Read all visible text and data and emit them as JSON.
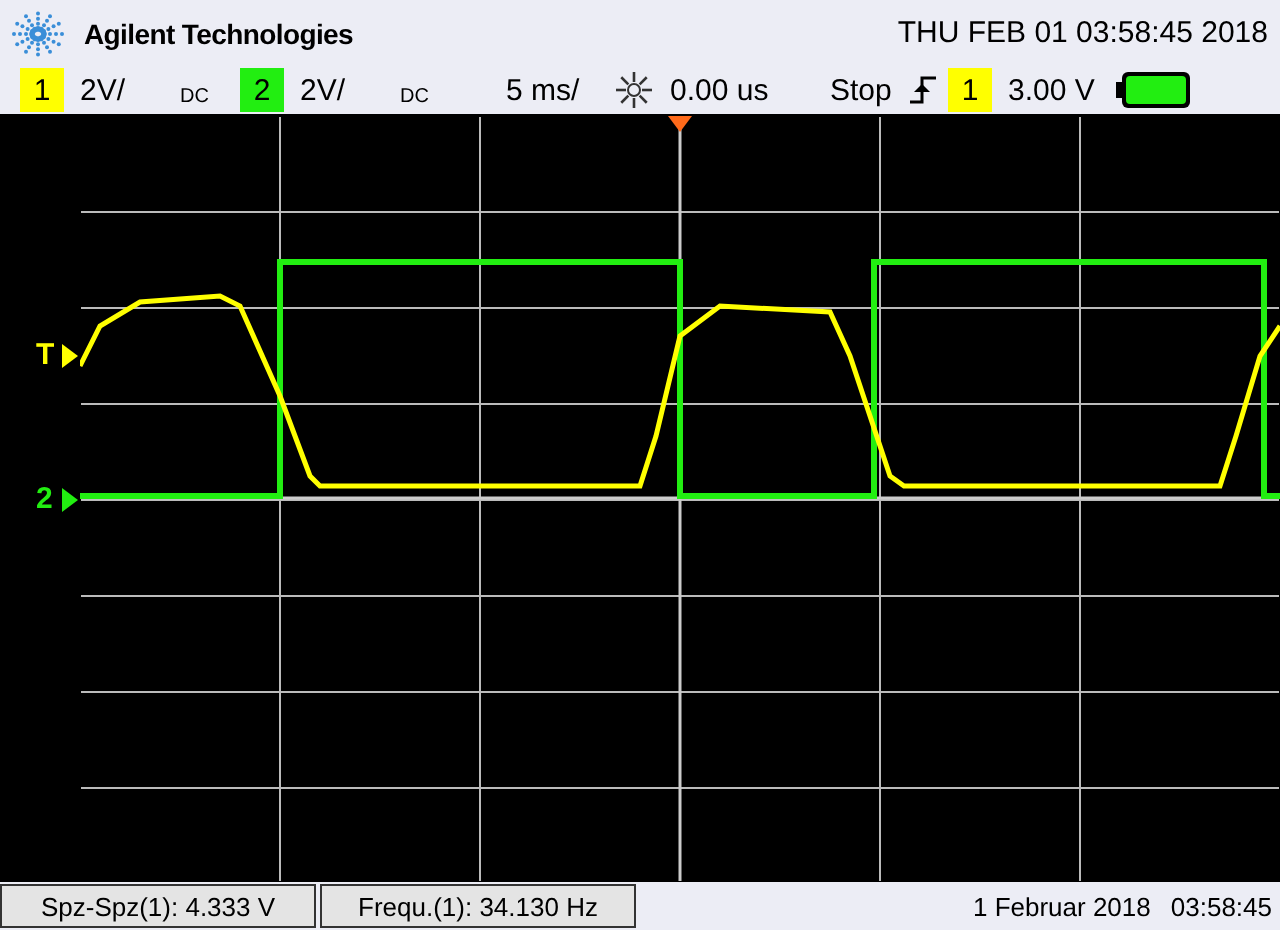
{
  "header": {
    "brand": "Agilent Technologies",
    "datetime": "THU FEB 01 03:58:45 2018"
  },
  "channels": [
    {
      "number": "1",
      "scale": "2V/",
      "coupling": "DC",
      "color": "#ffff00"
    },
    {
      "number": "2",
      "scale": "2V/",
      "coupling": "DC",
      "color": "#22ee11"
    }
  ],
  "timebase": "5 ms/",
  "delay": "0.00 us",
  "run_state": "Stop",
  "trigger": {
    "source": "1",
    "level": "3.00 V"
  },
  "markers": [
    {
      "label": "T",
      "color": "#ffff00",
      "kind": "trigger"
    },
    {
      "label": "2",
      "color": "#22ee11",
      "kind": "ground"
    }
  ],
  "measurements": [
    "Spz-Spz(1): 4.333 V",
    "Frequ.(1): 34.130 Hz"
  ],
  "footer": {
    "date": "1 Februar 2018",
    "time": "03:58:45"
  }
}
